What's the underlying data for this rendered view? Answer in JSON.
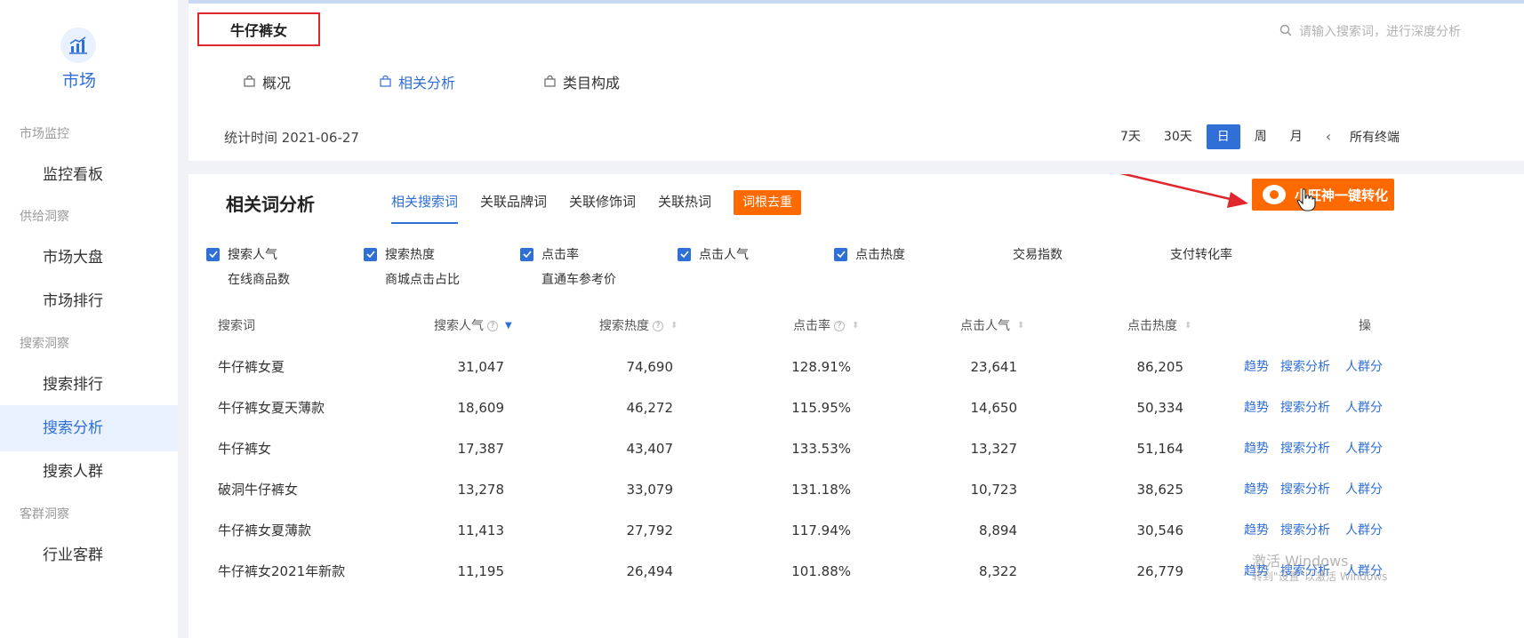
{
  "colors": {
    "accent": "#2f6fd6",
    "orange": "#ff6a00",
    "highlight_red": "#e0272e"
  },
  "sidebar": {
    "logo_icon": "market-chart-icon",
    "logo_label": "市场",
    "groups": [
      {
        "title": "市场监控",
        "items": [
          {
            "label": "监控看板"
          }
        ]
      },
      {
        "title": "供给洞察",
        "items": [
          {
            "label": "市场大盘"
          },
          {
            "label": "市场排行"
          }
        ]
      },
      {
        "title": "搜索洞察",
        "items": [
          {
            "label": "搜索排行"
          },
          {
            "label": "搜索分析",
            "active": true
          },
          {
            "label": "搜索人群"
          }
        ]
      },
      {
        "title": "客群洞察",
        "items": [
          {
            "label": "行业客群"
          }
        ]
      }
    ]
  },
  "header": {
    "keyword": "牛仔裤女",
    "search_placeholder": "请输入搜索词，进行深度分析",
    "tabs": [
      {
        "label": "概况",
        "icon": "bag-icon"
      },
      {
        "label": "相关分析",
        "icon": "bag-icon",
        "active": true
      },
      {
        "label": "类目构成",
        "icon": "bag-icon"
      }
    ],
    "stat_time": "统计时间 2021-06-27",
    "periods": [
      "7天",
      "30天",
      "日",
      "周",
      "月"
    ],
    "active_period": "日",
    "prev_arrow": "‹",
    "next_arrow": "›",
    "terminal": "所有终端"
  },
  "main": {
    "title": "相关词分析",
    "sub_tabs": [
      "相关搜索词",
      "关联品牌词",
      "关联修饰词",
      "关联热词"
    ],
    "active_sub_tab": "相关搜索词",
    "dedupe_label": "词根去重",
    "convert_label": "小旺神一键转化",
    "metrics": [
      {
        "label": "搜索人气",
        "checked": true
      },
      {
        "label": "搜索热度",
        "checked": true
      },
      {
        "label": "点击率",
        "checked": true
      },
      {
        "label": "点击人气",
        "checked": true
      },
      {
        "label": "点击热度",
        "checked": true
      },
      {
        "label": "交易指数",
        "checked": false
      },
      {
        "label": "支付转化率",
        "checked": false
      },
      {
        "label": "在线商品数",
        "checked": false
      },
      {
        "label": "商城点击占比",
        "checked": false
      },
      {
        "label": "直通车参考价",
        "checked": false
      }
    ],
    "table": {
      "columns": [
        "搜索词",
        "搜索人气",
        "搜索热度",
        "点击率",
        "点击人气",
        "点击热度",
        "操"
      ],
      "rows": [
        {
          "word": "牛仔裤女夏",
          "search_pop": "31,047",
          "search_heat": "74,690",
          "ctr": "128.91%",
          "click_pop": "23,641",
          "click_heat": "86,205"
        },
        {
          "word": "牛仔裤女夏天薄款",
          "search_pop": "18,609",
          "search_heat": "46,272",
          "ctr": "115.95%",
          "click_pop": "14,650",
          "click_heat": "50,334"
        },
        {
          "word": "牛仔裤女",
          "search_pop": "17,387",
          "search_heat": "43,407",
          "ctr": "133.53%",
          "click_pop": "13,327",
          "click_heat": "51,164"
        },
        {
          "word": "破洞牛仔裤女",
          "search_pop": "13,278",
          "search_heat": "33,079",
          "ctr": "131.18%",
          "click_pop": "10,723",
          "click_heat": "38,625"
        },
        {
          "word": "牛仔裤女夏薄款",
          "search_pop": "11,413",
          "search_heat": "27,792",
          "ctr": "117.94%",
          "click_pop": "8,894",
          "click_heat": "30,546"
        },
        {
          "word": "牛仔裤女2021年新款",
          "search_pop": "11,195",
          "search_heat": "26,494",
          "ctr": "101.88%",
          "click_pop": "8,322",
          "click_heat": "26,779"
        }
      ],
      "actions": [
        "趋势",
        "搜索分析",
        "人群分"
      ]
    },
    "watermark": "激活 Windows",
    "watermark_sub": "转到\"设置\"以激活 Windows"
  }
}
